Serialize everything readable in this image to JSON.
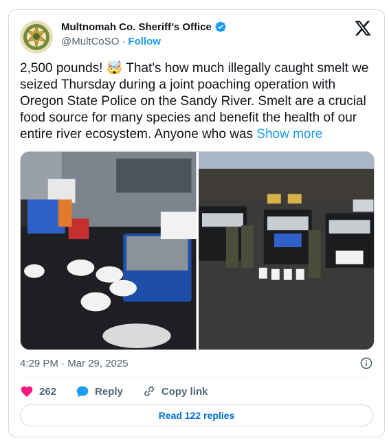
{
  "account": {
    "display_name": "Multnomah Co. Sheriff’s Office",
    "handle": "@MultCoSO",
    "separator": "·",
    "follow_label": "Follow",
    "verified": true,
    "avatar_icon": "sheriff-star-badge"
  },
  "tweet": {
    "text": "2,500 pounds! 🤯 That's how much illegally caught smelt we seized Thursday during a joint poaching operation with Oregon State Police on the Sandy River. Smelt are a crucial food source for many species and benefit the health of our entire river ecosystem. Anyone who was ",
    "show_more_label": "Show more",
    "timestamp": "4:29 PM · Mar 29, 2025"
  },
  "media": [
    {
      "icon": "photo-smelt-coolers-truck-bed"
    },
    {
      "icon": "photo-officers-with-trucks"
    }
  ],
  "actions": {
    "likes_count": "262",
    "reply_label": "Reply",
    "copy_link_label": "Copy link"
  },
  "read_replies_label": "Read 122 replies",
  "colors": {
    "accent": "#1d9bf0",
    "like": "#f91880",
    "text": "#0f1419",
    "muted": "#536471",
    "border": "#cfd9de"
  }
}
